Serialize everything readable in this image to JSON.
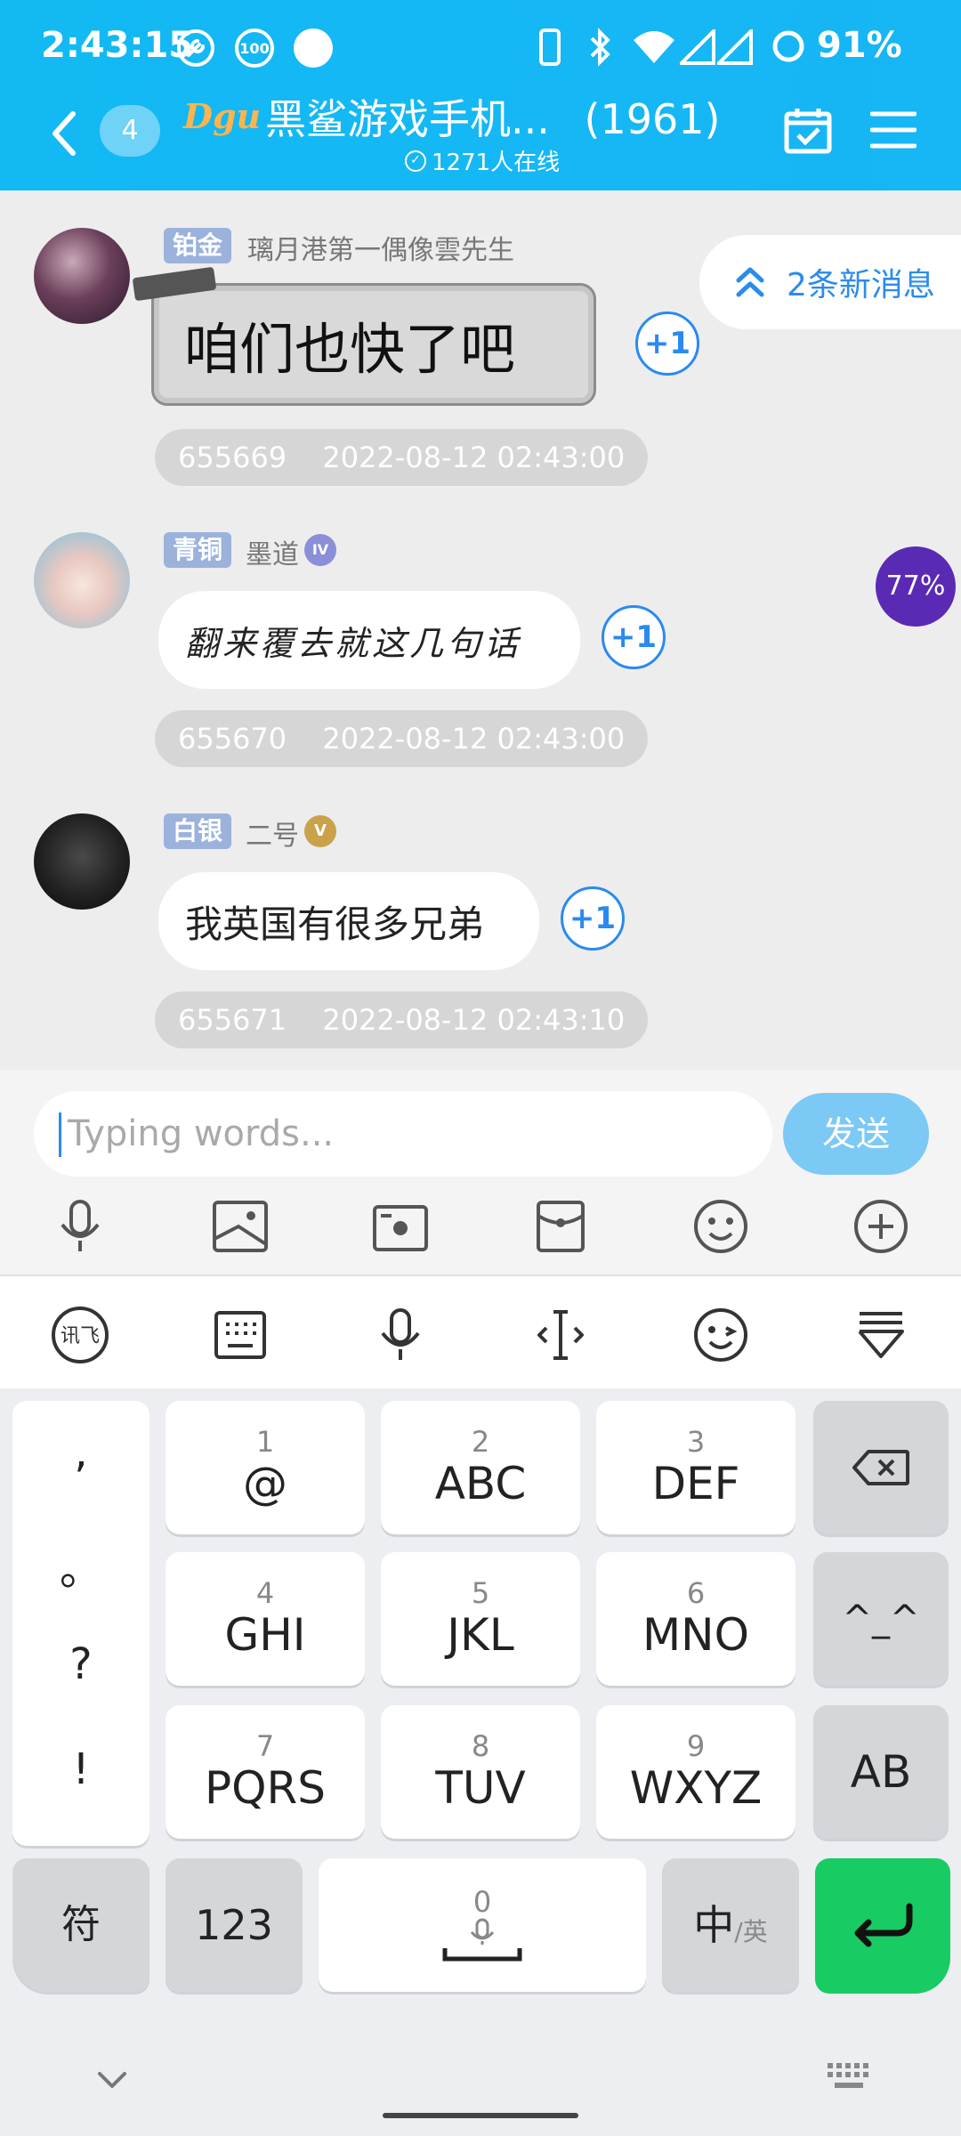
{
  "status_bar": {
    "time": "2:43:15",
    "badge_100": "100",
    "battery": "91%"
  },
  "header": {
    "back_label": "‹",
    "unread_count": "4",
    "logo_text": "Dgu",
    "title": "黑鲨游戏手机...",
    "member_count": "(1961)",
    "online": "1271人在线"
  },
  "new_messages": "2条新消息",
  "progress_percent": "77%",
  "messages": [
    {
      "rank": "铂金",
      "sender": "璃月港第一偶像雲先生",
      "text": "咱们也快了吧",
      "plus": "+1",
      "id": "655669",
      "time": "2022-08-12 02:43:00"
    },
    {
      "rank": "青铜",
      "sender": "墨道",
      "text": "翻来覆去就这几句话",
      "plus": "+1",
      "id": "655670",
      "time": "2022-08-12 02:43:00"
    },
    {
      "rank": "白银",
      "sender": "二号",
      "text": "我英国有很多兄弟",
      "plus": "+1",
      "id": "655671",
      "time": "2022-08-12 02:43:10"
    }
  ],
  "input": {
    "placeholder": "Typing words...",
    "send_label": "发送"
  },
  "keyboard": {
    "punct": [
      ",",
      "。",
      "?",
      "!"
    ],
    "keys": [
      {
        "num": "1",
        "main": "@"
      },
      {
        "num": "2",
        "main": "ABC"
      },
      {
        "num": "3",
        "main": "DEF"
      },
      {
        "num": "4",
        "main": "GHI"
      },
      {
        "num": "5",
        "main": "JKL"
      },
      {
        "num": "6",
        "main": "MNO"
      },
      {
        "num": "7",
        "main": "PQRS"
      },
      {
        "num": "8",
        "main": "TUV"
      },
      {
        "num": "9",
        "main": "WXYZ"
      }
    ],
    "emoticon": "^_^",
    "ab": "AB",
    "symbol": "符",
    "numeric": "123",
    "space_num": "0",
    "lang_main": "中",
    "lang_sub": "/英"
  },
  "colors": {
    "header_bg": "#12b9f3",
    "accent": "#2a8af0",
    "enter": "#18cc63",
    "progress": "#5a2ab4"
  }
}
